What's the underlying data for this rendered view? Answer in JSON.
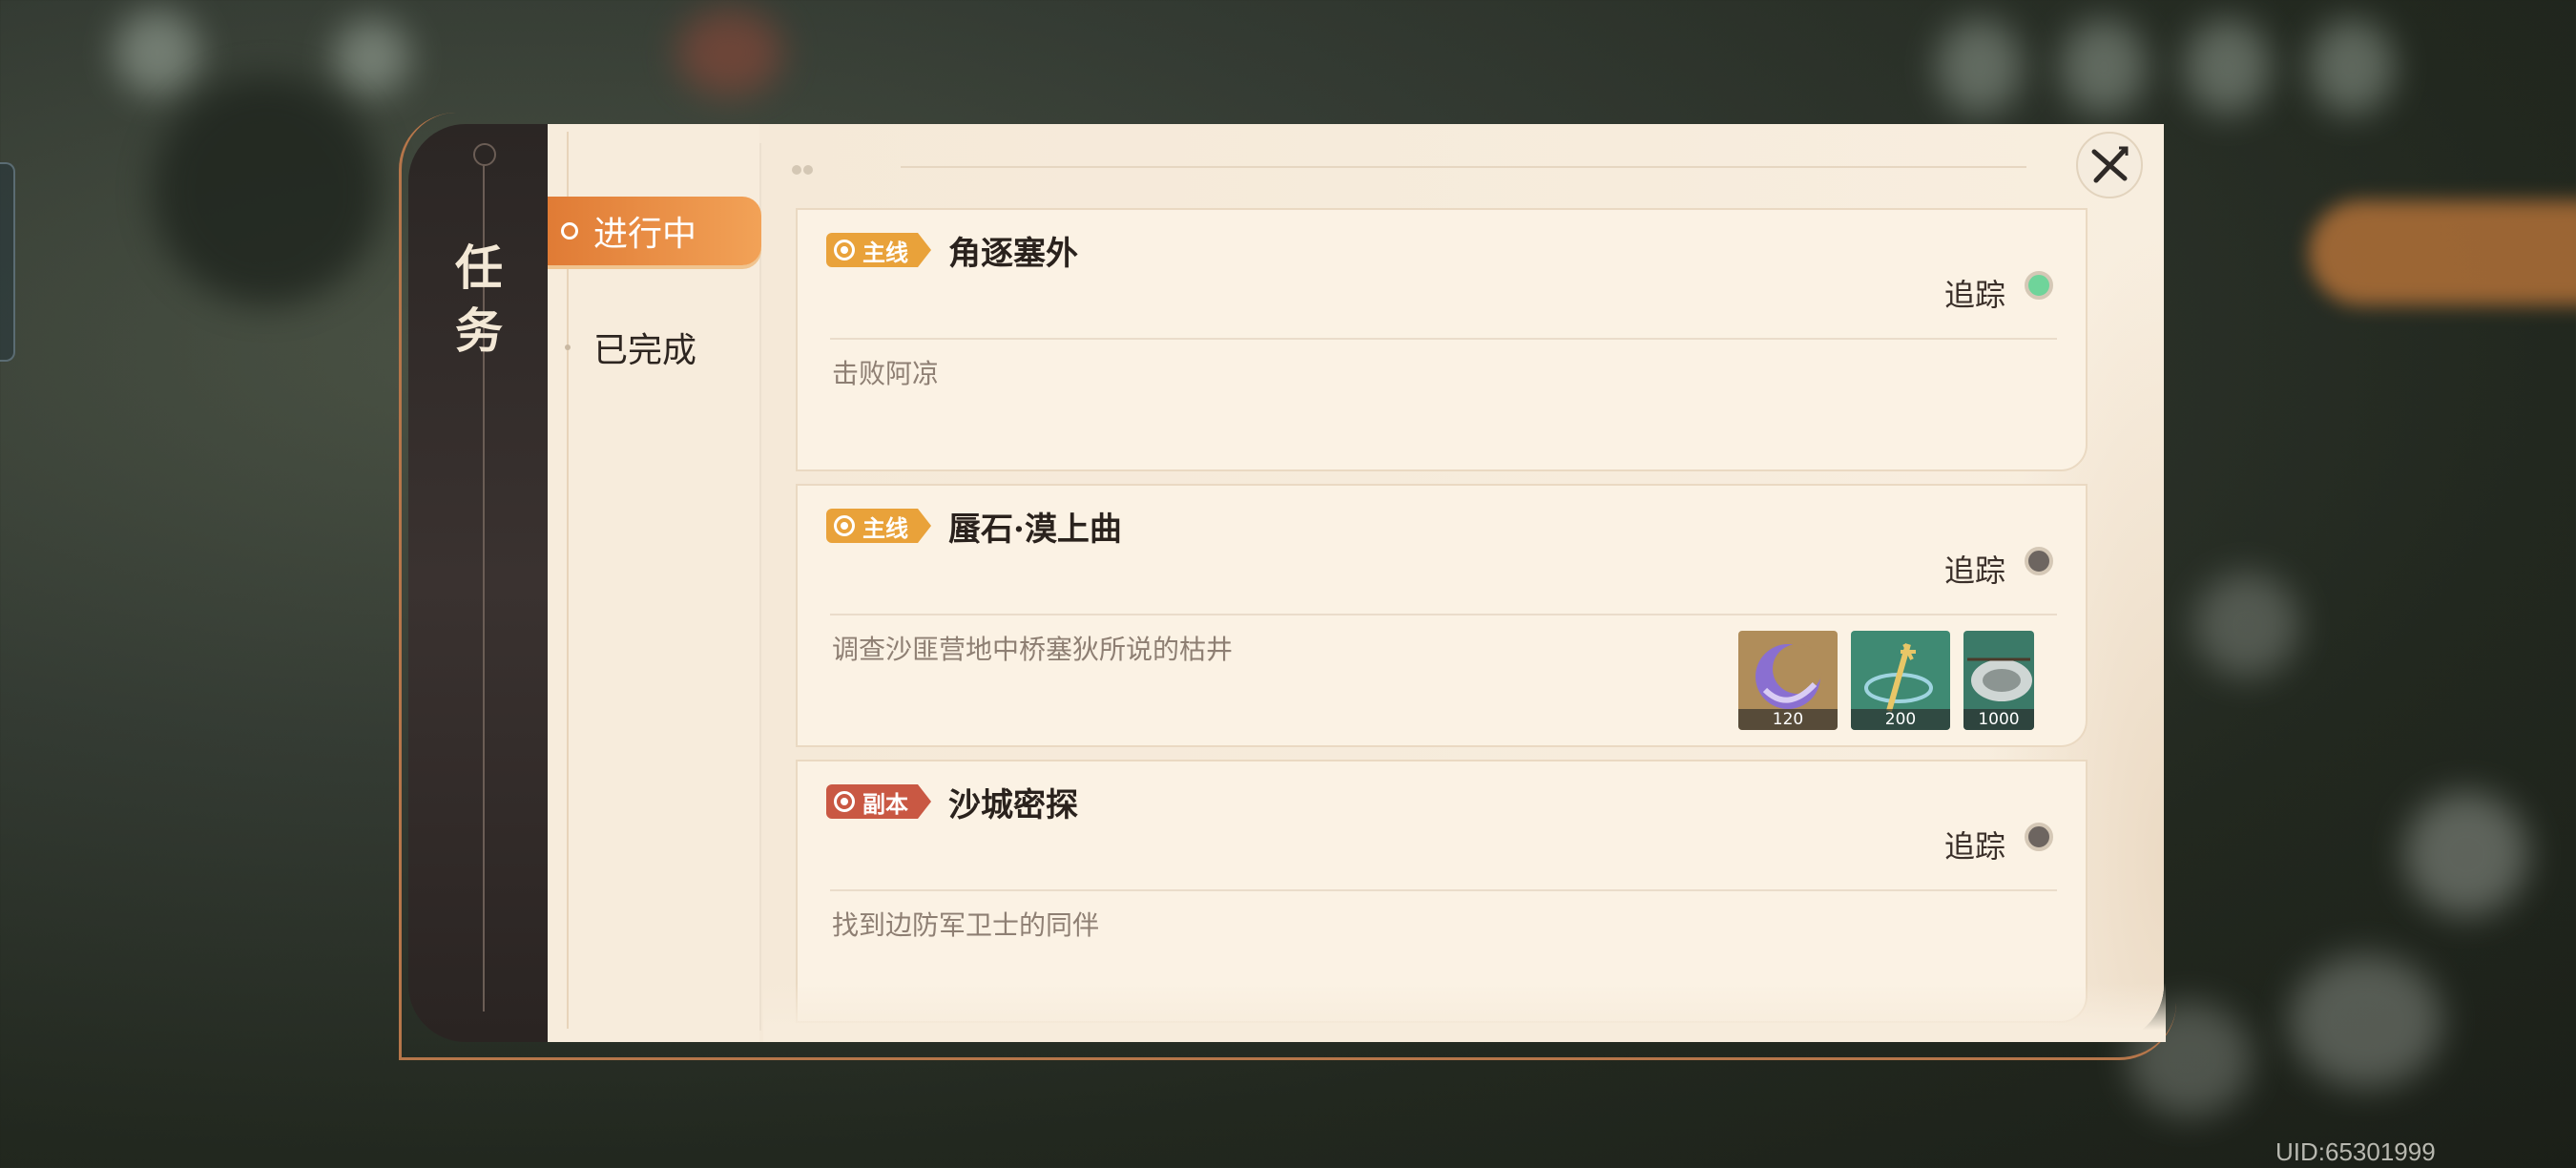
{
  "panel": {
    "title": "任务",
    "close_icon": "close-x-icon"
  },
  "tabs": [
    {
      "label": "进行中",
      "active": true
    },
    {
      "label": "已完成",
      "active": false
    }
  ],
  "quests": [
    {
      "tag": "主线",
      "tag_type": "main",
      "title": "角逐塞外",
      "track_label": "追踪",
      "tracked": true,
      "description": "击败阿凉",
      "rewards": []
    },
    {
      "tag": "主线",
      "tag_type": "main",
      "title": "蜃石·漠上曲",
      "track_label": "追踪",
      "tracked": false,
      "description": "调查沙匪营地中桥塞狄所说的枯井",
      "rewards": [
        {
          "icon": "purple-crescent-item-icon",
          "quantity": "120"
        },
        {
          "icon": "golden-trident-item-icon",
          "quantity": "200"
        },
        {
          "icon": "silver-coin-item-icon",
          "quantity": "1000"
        }
      ]
    },
    {
      "tag": "副本",
      "tag_type": "dungeon",
      "title": "沙城密探",
      "track_label": "追踪",
      "tracked": false,
      "description": "找到边防军卫士的同伴",
      "rewards": []
    }
  ],
  "uid": "UID:65301999",
  "colors": {
    "accent_orange": "#e07b35",
    "tag_main": "#e9a23a",
    "tag_dungeon": "#c95843",
    "tracked_green": "#6fd49a",
    "panel_bg": "#f7ecdc",
    "title_bar": "#2b2624"
  }
}
